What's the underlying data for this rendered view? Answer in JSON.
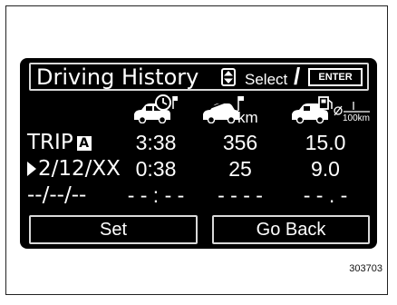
{
  "header": {
    "title": "Driving History",
    "select_label": "Select",
    "slash": "/",
    "enter_label": "ENTER"
  },
  "columns": {
    "time_icon": "car-clock-flag-icon",
    "distance_icon": "car-road-flag-icon",
    "distance_unit": "km",
    "fuel_icon": "car-fuel-pump-icon",
    "fuel_unit": "l/100km"
  },
  "rows": [
    {
      "label": "TRIP",
      "badge": "A",
      "time": "3:38",
      "distance": "356",
      "fuel": "15.0"
    },
    {
      "label": "2/12/XX",
      "time": "0:38",
      "distance": "25",
      "fuel": "9.0"
    },
    {
      "label": "--/--/--",
      "time": "- - : - -",
      "distance": "- - - -",
      "fuel": "- - . -"
    }
  ],
  "buttons": {
    "set": "Set",
    "go_back": "Go Back"
  },
  "figure_code": "303703",
  "colors": {
    "screen_bg": "#000000",
    "text": "#ffffff",
    "border": "#d9d9d9"
  }
}
